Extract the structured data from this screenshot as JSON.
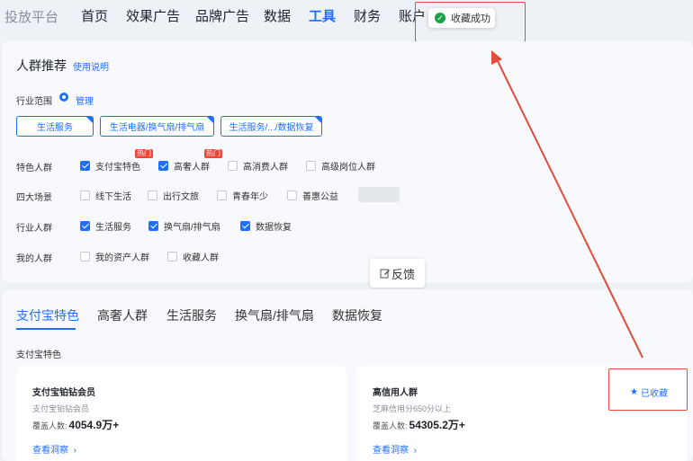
{
  "nav": {
    "brand": "投放平台",
    "items": [
      "首页",
      "效果广告",
      "品牌广告",
      "数据",
      "工具",
      "财务",
      "账户"
    ],
    "active": "工具"
  },
  "toast": {
    "text": "收藏成功",
    "icon": "check-circle-icon"
  },
  "crowd": {
    "title": "人群推荐",
    "help_link": "使用说明",
    "industry_label": "行业范围",
    "manage": "管理",
    "chips": [
      "生活服务",
      "生活电器/换气扇/排气扇",
      "生活服务/.../数据恢复"
    ],
    "rows": [
      {
        "label": "特色人群",
        "options": [
          {
            "text": "支付宝特色",
            "checked": true,
            "hot": "热门"
          },
          {
            "text": "高奢人群",
            "checked": true,
            "hot": "热门"
          },
          {
            "text": "高消费人群",
            "checked": false
          },
          {
            "text": "高级岗位人群",
            "checked": false
          }
        ]
      },
      {
        "label": "四大场景",
        "options": [
          {
            "text": "线下生活",
            "checked": false
          },
          {
            "text": "出行文旅",
            "checked": false
          },
          {
            "text": "青春年少",
            "checked": false
          },
          {
            "text": "善惠公益",
            "checked": false
          }
        ]
      },
      {
        "label": "行业人群",
        "options": [
          {
            "text": "生活服务",
            "checked": true
          },
          {
            "text": "换气扇/排气扇",
            "checked": true
          },
          {
            "text": "数据恢复",
            "checked": true
          }
        ]
      },
      {
        "label": "我的人群",
        "options": [
          {
            "text": "我的资产人群",
            "checked": false
          },
          {
            "text": "收藏人群",
            "checked": false
          }
        ]
      }
    ]
  },
  "feedback": "反馈",
  "tabs": [
    "支付宝特色",
    "高奢人群",
    "生活服务",
    "换气扇/排气扇",
    "数据恢复"
  ],
  "section_title": "支付宝特色",
  "cards": [
    {
      "title": "支付宝铂钻会员",
      "subtitle": "支付宝铂钻会员",
      "cover_label": "覆盖人数:",
      "cover_value": "4054.9万+",
      "link": "查看洞察"
    },
    {
      "title": "高信用人群",
      "subtitle": "芝麻信用分650分以上",
      "cover_label": "覆盖人数:",
      "cover_value": "54305.2万+",
      "link": "查看洞察",
      "favorite": "已收藏"
    }
  ],
  "colors": {
    "accent": "#1f6fff",
    "annotation": "#e34b3a",
    "hot": "#f04438",
    "success": "#1aa34a"
  }
}
